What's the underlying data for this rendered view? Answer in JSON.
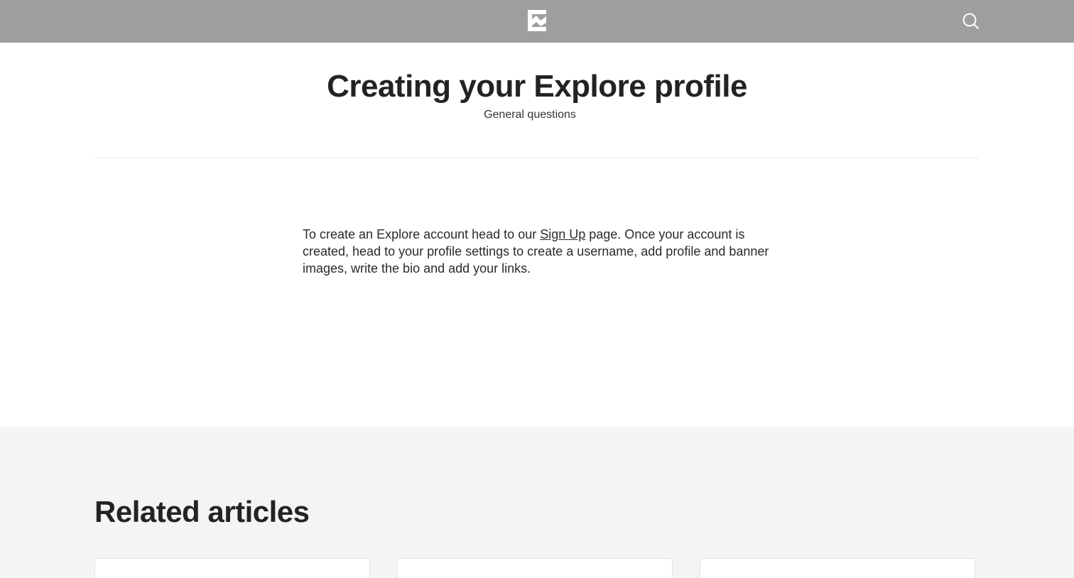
{
  "header": {
    "logo_icon": "explore-logo-icon",
    "search_icon": "search-icon",
    "background_color": "#9e9e9e"
  },
  "article": {
    "title": "Creating your Explore profile",
    "category": "General questions",
    "body_before_link": "To create an Explore account head to our ",
    "link_text": "Sign Up",
    "body_after_link": " page. Once your account is created, head to your profile settings to create a username, add profile and banner images, write the bio and add your links."
  },
  "related": {
    "title": "Related articles",
    "background_color": "#f4f4f4"
  }
}
